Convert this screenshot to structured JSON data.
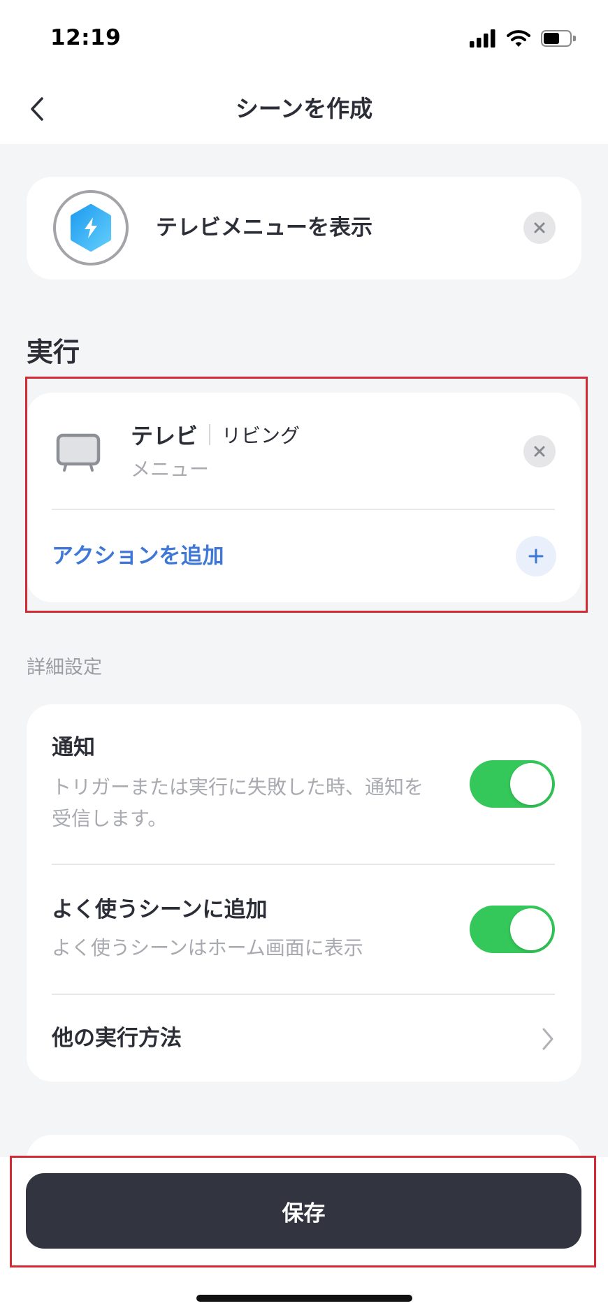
{
  "status_bar": {
    "time": "12:19",
    "icons": [
      "cellular-signal-icon",
      "wifi-icon",
      "battery-icon"
    ],
    "battery_level": 0.6
  },
  "header": {
    "title": "シーンを作成",
    "back_icon": "chevron-left-icon"
  },
  "scene": {
    "name": "テレビメニューを表示",
    "icon": "lightning-hexagon-icon",
    "remove_icon": "close-icon"
  },
  "execution": {
    "heading": "実行",
    "actions": [
      {
        "device": "テレビ",
        "room": "リビング",
        "action": "メニュー",
        "icon": "tv-icon"
      }
    ],
    "add_action_label": "アクションを追加",
    "add_icon": "plus-icon"
  },
  "advanced": {
    "heading": "詳細設定",
    "notify": {
      "title": "通知",
      "description": "トリガーまたは実行に失敗した時、通知を受信します。",
      "enabled": true
    },
    "favorite": {
      "title": "よく使うシーンに追加",
      "description": "よく使うシーンはホーム画面に表示",
      "enabled": true
    },
    "other_methods": {
      "title": "他の実行方法",
      "icon": "chevron-right-icon"
    }
  },
  "footer": {
    "save_label": "保存"
  },
  "colors": {
    "accent_blue": "#3f77d6",
    "toggle_on": "#34c759",
    "save_button": "#32353f",
    "highlight": "#d42a36"
  }
}
